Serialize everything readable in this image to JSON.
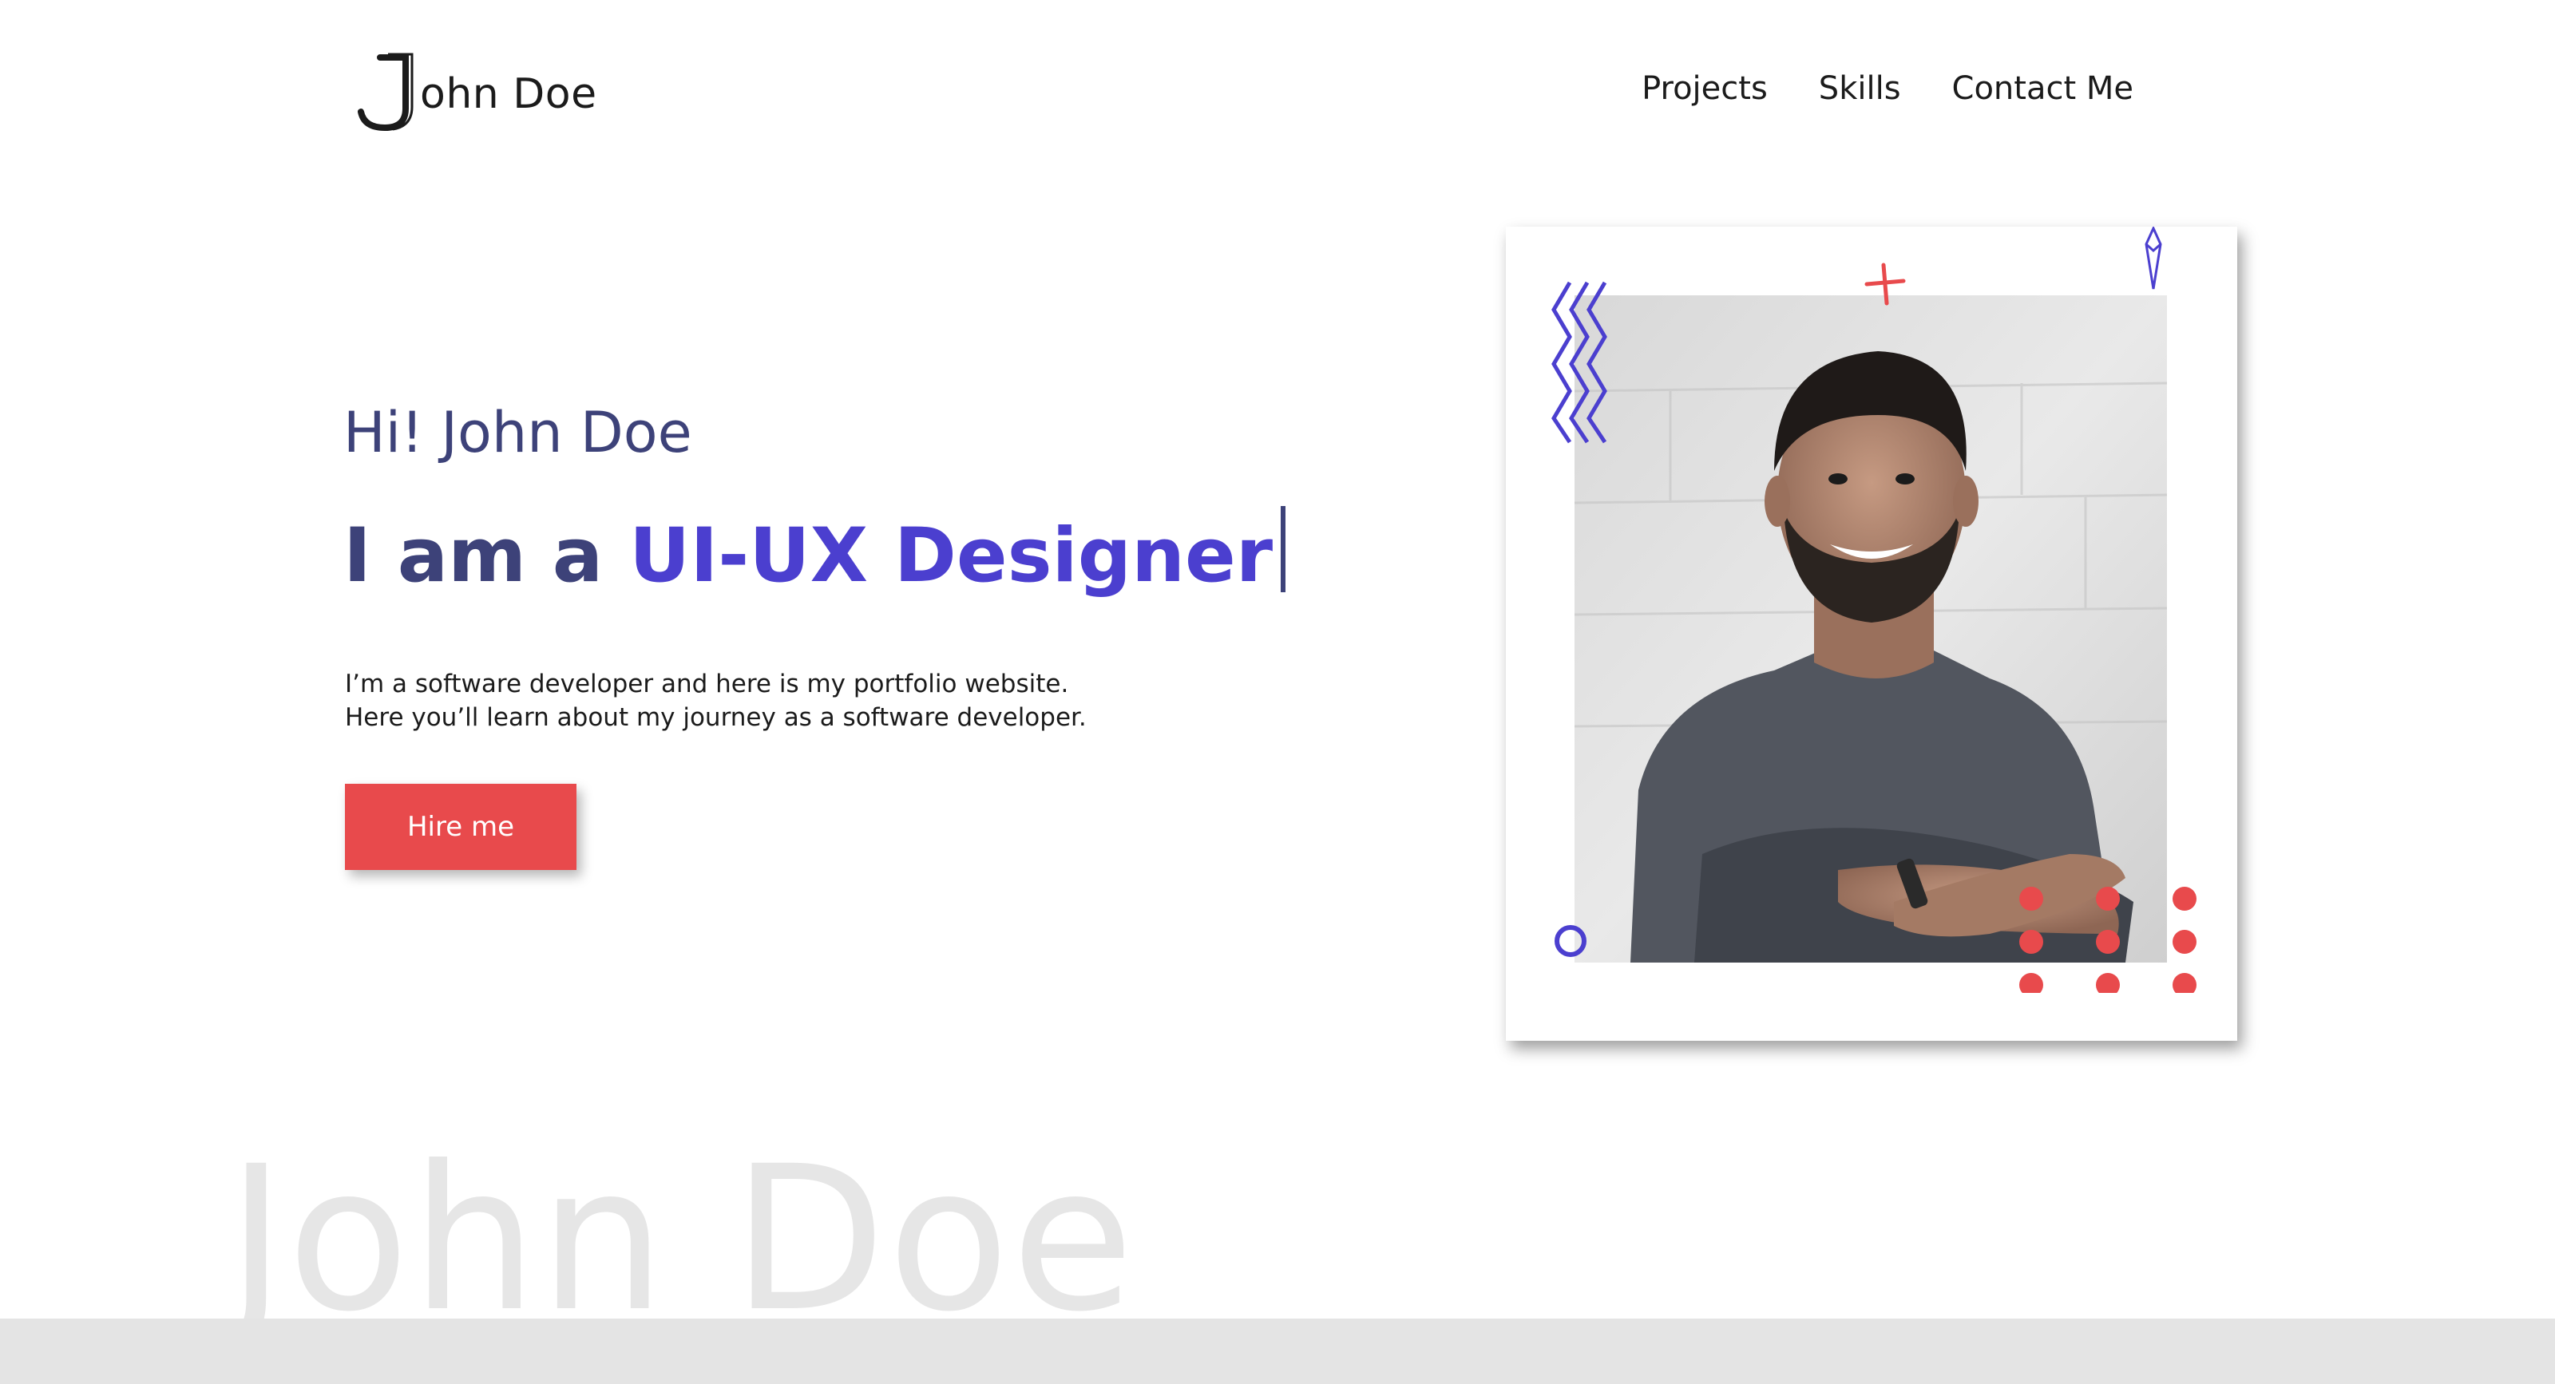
{
  "header": {
    "logo_text": "ohn Doe",
    "logo_icon": "letter-j-logo-icon",
    "nav": [
      "Projects",
      "Skills",
      "Contact Me"
    ]
  },
  "hero": {
    "greeting": "Hi! John Doe",
    "role_prefix": "I am a",
    "role_highlight": "UI-UX Designer",
    "description_line1": "I’m a software developer and here is my portfolio website.",
    "description_line2": "Here you’ll learn about my journey as a software developer.",
    "cta_label": "Hire me"
  },
  "photo": {
    "subject": "smiling man with beard in grey t-shirt, arms crossed",
    "decorations": [
      "zigzag-icon",
      "plus-icon",
      "crystal-icon",
      "ring-icon",
      "dot-grid-icon"
    ]
  },
  "background_text": "John Doe",
  "colors": {
    "heading": "#3d4279",
    "accent": "#4b3fcf",
    "button": "#e84a4c",
    "dots": "#e84a4c",
    "watermark": "#e6e6e6",
    "bottom_band": "#e4e4e4"
  }
}
